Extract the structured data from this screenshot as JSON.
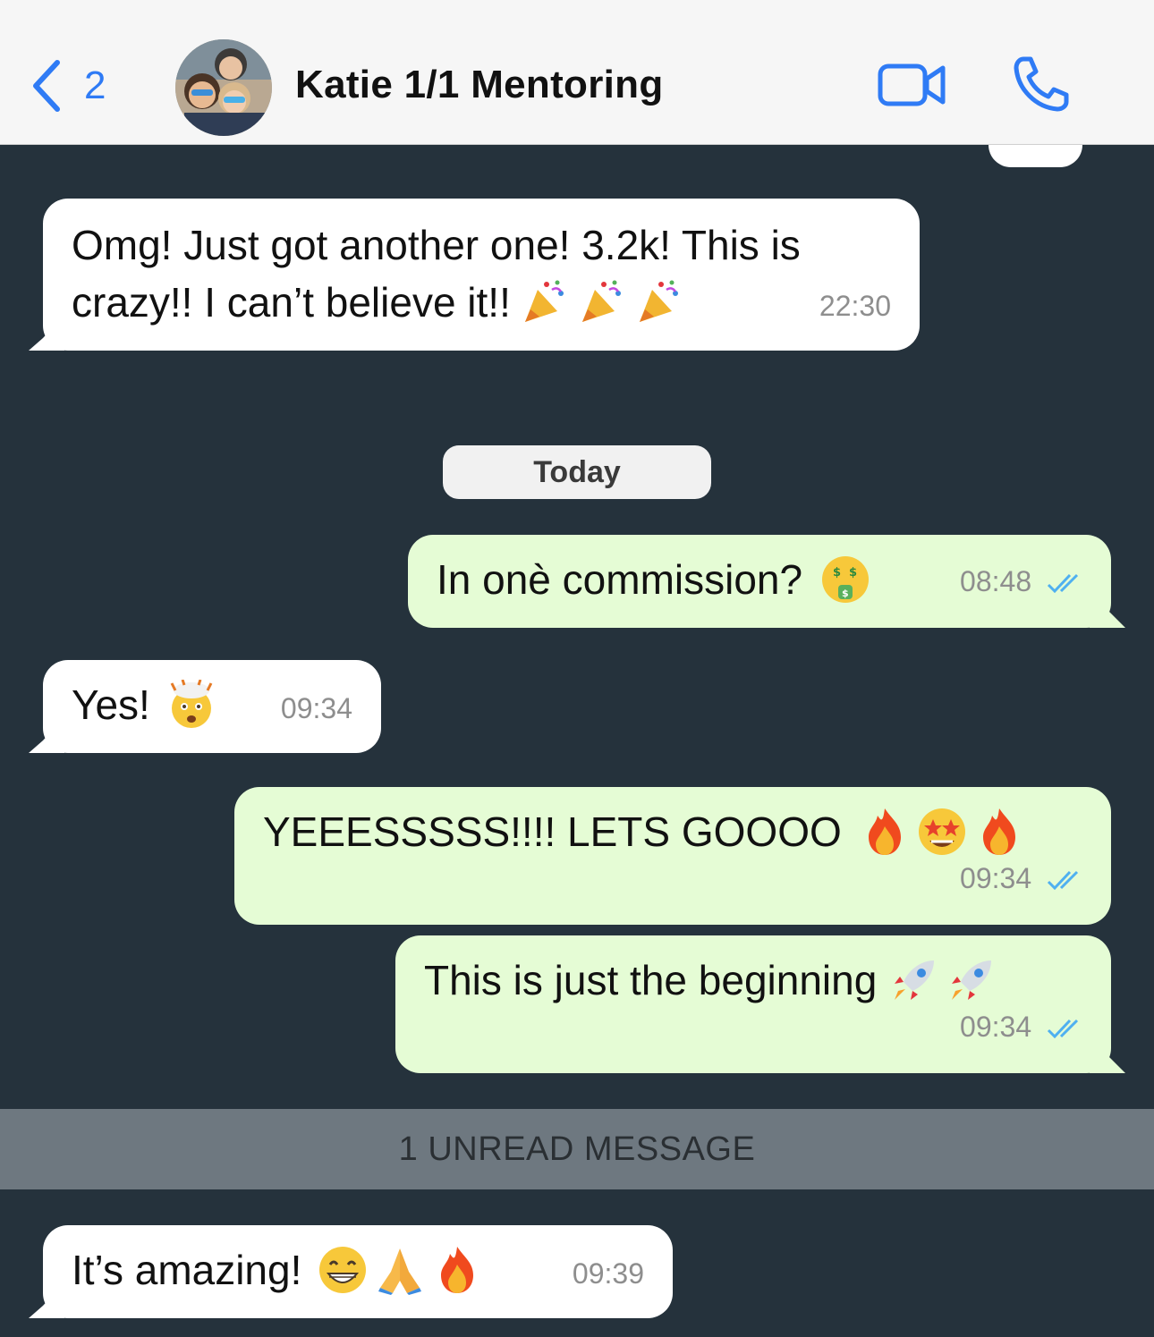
{
  "header": {
    "back_count": "2",
    "title": "Katie 1/1 Mentoring"
  },
  "colors": {
    "accent": "#2f7bf5",
    "chat_bg": "#25323c",
    "incoming_bubble": "#ffffff",
    "outgoing_bubble": "#e5fcd5",
    "read_ticks": "#4fb0f0"
  },
  "messages": [
    {
      "direction": "in",
      "text_line1": "Omg! Just got another one! 3.2k! This is",
      "text_line2": "crazy!! I can’t believe it!!",
      "emojis": [
        "party-popper",
        "party-popper",
        "party-popper"
      ],
      "time": "22:30"
    },
    {
      "direction": "out",
      "text": "In onè commission?",
      "emojis": [
        "money-mouth-face"
      ],
      "time": "08:48",
      "read": true
    },
    {
      "direction": "in",
      "text": "Yes!",
      "emojis": [
        "exploding-head"
      ],
      "time": "09:34"
    },
    {
      "direction": "out",
      "text": "YEEESSSSS!!!! LETS GOOOO",
      "emojis": [
        "fire",
        "star-struck",
        "fire"
      ],
      "time": "09:34",
      "read": true
    },
    {
      "direction": "out",
      "text": "This is just the beginning",
      "emojis": [
        "rocket",
        "rocket"
      ],
      "time": "09:34",
      "read": true
    },
    {
      "direction": "in",
      "text": "It’s amazing!",
      "emojis": [
        "grinning-face",
        "folded-hands",
        "fire"
      ],
      "time": "09:39"
    }
  ],
  "date_divider": "Today",
  "unread_divider": "1 UNREAD MESSAGE"
}
